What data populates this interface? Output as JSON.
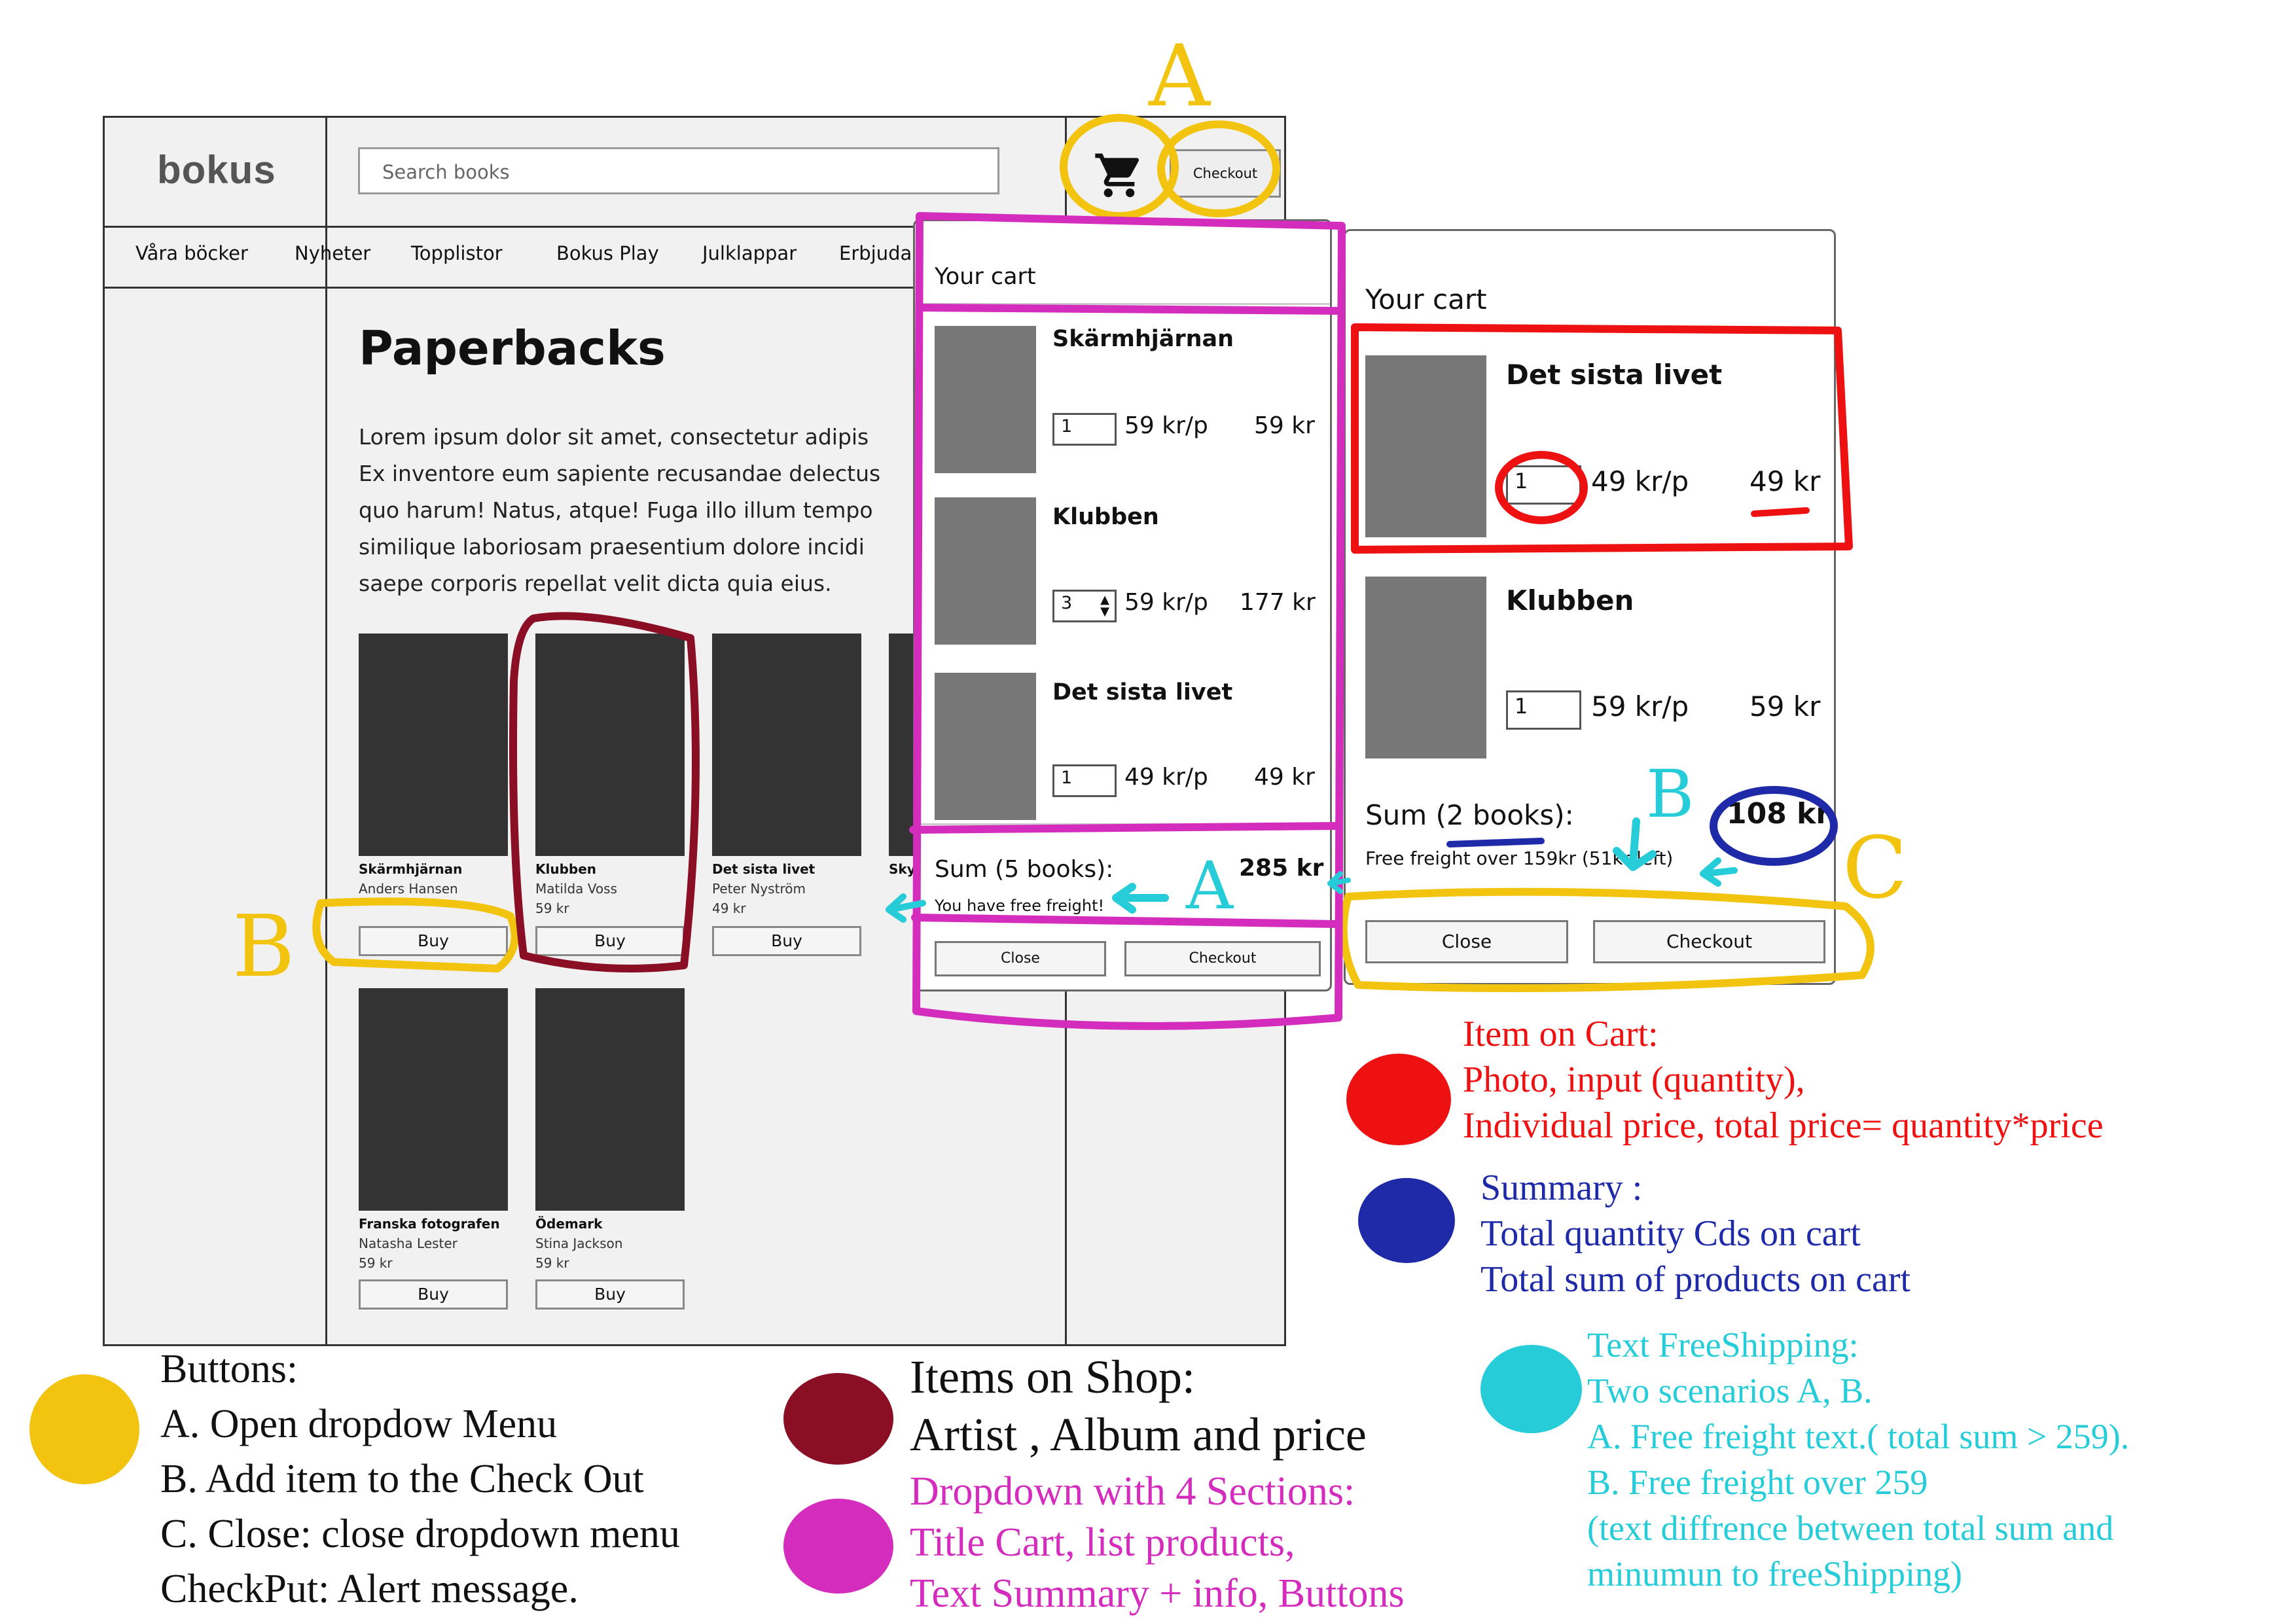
{
  "header": {
    "logo": "bokus",
    "search_placeholder": "Search books",
    "checkout_label": "Checkout"
  },
  "nav": [
    "Våra böcker",
    "Nyheter",
    "Topplistor",
    "Bokus Play",
    "Julklappar",
    "Erbjudar"
  ],
  "main": {
    "title": "Paperbacks",
    "lorem": "Lorem ipsum dolor sit amet, consectetur adipis\nEx inventore eum sapiente recusandae delectus\nquo harum! Natus, atque! Fuga illo illum tempo\nsimilique laboriosam praesentium dolore incidi\nsaepe corporis repellat velit dicta quia eius."
  },
  "products": [
    {
      "title": "Skärmhjärnan",
      "author": "Anders Hansen",
      "price": "",
      "buy": "Buy"
    },
    {
      "title": "Klubben",
      "author": "Matilda Voss",
      "price": "59 kr",
      "buy": "Buy"
    },
    {
      "title": "Det sista livet",
      "author": "Peter Nyström",
      "price": "49 kr",
      "buy": "Buy"
    },
    {
      "title": "Skyt",
      "author": "",
      "price": "",
      "buy": ""
    },
    {
      "title": "Franska fotografen",
      "author": "Natasha Lester",
      "price": "59 kr",
      "buy": "Buy"
    },
    {
      "title": "Ödemark",
      "author": "Stina Jackson",
      "price": "59 kr",
      "buy": "Buy"
    }
  ],
  "cart_a": {
    "title": "Your cart",
    "items": [
      {
        "name": "Skärmhjärnan",
        "qty": "1",
        "unit": "59 kr/p",
        "total": "59 kr"
      },
      {
        "name": "Klubben",
        "qty": "3",
        "unit": "59 kr/p",
        "total": "177 kr"
      },
      {
        "name": "Det sista livet",
        "qty": "1",
        "unit": "49 kr/p",
        "total": "49 kr"
      }
    ],
    "sum_label": "Sum (5 books):",
    "sum_value": "285 kr",
    "info": "You have free freight!",
    "close": "Close",
    "checkout": "Checkout"
  },
  "cart_b": {
    "title": "Your cart",
    "items": [
      {
        "name": "Det sista livet",
        "qty": "1",
        "unit": "49 kr/p",
        "total": "49 kr"
      },
      {
        "name": "Klubben",
        "qty": "1",
        "unit": "59 kr/p",
        "total": "59 kr"
      }
    ],
    "sum_label": "Sum (2 books):",
    "sum_value": "108 kr",
    "info": "Free freight over 159kr (51kr left)",
    "close": "Close",
    "checkout": "Checkout"
  },
  "annotation_letters": {
    "a_top": "A",
    "b_left": "B",
    "a_cart": "A",
    "b_cart": "B",
    "c_cart": "C"
  },
  "legend": {
    "buttons": "Buttons:\nA. Open dropdow Menu\nB. Add item to the Check Out\nC. Close: close dropdown menu\nCheckPut: Alert message.",
    "shop_items": "Items on Shop:\nArtist , Album and price",
    "dropdown": "Dropdown with 4 Sections:\nTitle Cart, list products,\nText Summary + info, Buttons",
    "item_on_cart": "Item on Cart:\nPhoto, input (quantity),\nIndividual price, total price= quantity*price",
    "summary": "Summary :\nTotal quantity Cds on cart\nTotal sum of products on cart",
    "free_shipping": "Text FreeShipping:\nTwo scenarios A, B.\nA. Free freight text.( total sum > 259).\nB. Free freight over 259\n(text diffrence between total sum and\nminumun to freeShipping)"
  },
  "colors": {
    "yellow": "#F2C40F",
    "maroon": "#8A0F24",
    "magenta": "#D42DBE",
    "red": "#EE1111",
    "navy": "#1F2AA8",
    "cyan": "#26CCD8"
  }
}
